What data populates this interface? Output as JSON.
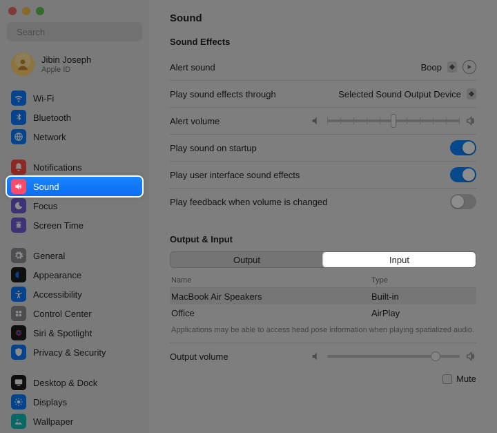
{
  "search": {
    "placeholder": "Search"
  },
  "account": {
    "name": "Jibin Joseph",
    "sub": "Apple ID"
  },
  "sidebar": {
    "groups": [
      {
        "items": [
          {
            "label": "Wi-Fi",
            "icon": "wifi",
            "bg": "#0a7cff"
          },
          {
            "label": "Bluetooth",
            "icon": "bluetooth",
            "bg": "#0a7cff"
          },
          {
            "label": "Network",
            "icon": "network",
            "bg": "#0a7cff"
          }
        ]
      },
      {
        "items": [
          {
            "label": "Notifications",
            "icon": "bell",
            "bg": "#ff4b3e"
          },
          {
            "label": "Sound",
            "icon": "sound",
            "bg": "#ff4b6a",
            "selected": true
          },
          {
            "label": "Focus",
            "icon": "focus",
            "bg": "#6e5bd6"
          },
          {
            "label": "Screen Time",
            "icon": "screentime",
            "bg": "#6e5bd6"
          }
        ]
      },
      {
        "items": [
          {
            "label": "General",
            "icon": "gear",
            "bg": "#8e8e93"
          },
          {
            "label": "Appearance",
            "icon": "appearance",
            "bg": "#1c1c1e"
          },
          {
            "label": "Accessibility",
            "icon": "a11y",
            "bg": "#0a7cff"
          },
          {
            "label": "Control Center",
            "icon": "control",
            "bg": "#8e8e93"
          },
          {
            "label": "Siri & Spotlight",
            "icon": "siri",
            "bg": "#1c1c1e"
          },
          {
            "label": "Privacy & Security",
            "icon": "privacy",
            "bg": "#0a7cff"
          }
        ]
      },
      {
        "items": [
          {
            "label": "Desktop & Dock",
            "icon": "desktop",
            "bg": "#1c1c1e"
          },
          {
            "label": "Displays",
            "icon": "displays",
            "bg": "#0a7cff"
          },
          {
            "label": "Wallpaper",
            "icon": "wallpaper",
            "bg": "#0fbdbd"
          }
        ]
      }
    ]
  },
  "page": {
    "title": "Sound",
    "effects": {
      "heading": "Sound Effects",
      "alert_sound_label": "Alert sound",
      "alert_sound_value": "Boop",
      "play_through_label": "Play sound effects through",
      "play_through_value": "Selected Sound Output Device",
      "alert_volume_label": "Alert volume",
      "alert_volume_percent": 50,
      "startup_label": "Play sound on startup",
      "startup_on": true,
      "ui_sounds_label": "Play user interface sound effects",
      "ui_sounds_on": true,
      "feedback_label": "Play feedback when volume is changed",
      "feedback_on": false
    },
    "io": {
      "heading": "Output & Input",
      "tab_output": "Output",
      "tab_input": "Input",
      "active_tab": "Input",
      "col_name": "Name",
      "col_type": "Type",
      "devices": [
        {
          "name": "MacBook Air Speakers",
          "type": "Built-in"
        },
        {
          "name": "Office",
          "type": "AirPlay"
        }
      ],
      "note": "Applications may be able to access head pose information when playing spatialized audio.",
      "output_volume_label": "Output volume",
      "output_volume_percent": 82,
      "mute_label": "Mute",
      "mute_checked": false
    }
  }
}
